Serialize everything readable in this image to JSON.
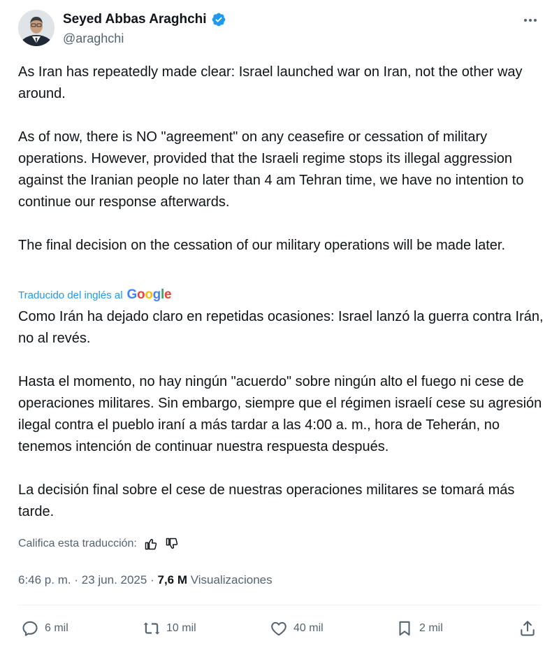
{
  "author": {
    "name": "Seyed Abbas Araghchi",
    "handle": "@araghchi",
    "verified_color": "#1d9bf0"
  },
  "tweet": {
    "paragraphs": [
      "As Iran has repeatedly made clear: Israel launched war on Iran, not the other way around.",
      "As of now, there is NO \"agreement\" on any ceasefire or cessation of military operations. However, provided that the Israeli regime stops its illegal aggression against the Iranian people no later than 4 am Tehran time, we have no intention to continue our response afterwards.",
      "The final decision on the cessation of our military operations will be made later."
    ]
  },
  "translation": {
    "label": "Traducido del inglés al",
    "brand": "Google",
    "paragraphs": [
      "Como Irán ha dejado claro en repetidas ocasiones: Israel lanzó la guerra contra Irán, no al revés.",
      "Hasta el momento, no hay ningún \"acuerdo\" sobre ningún alto el fuego ni cese de operaciones militares. Sin embargo, siempre que el régimen israelí cese su agresión ilegal contra el pueblo iraní a más tardar a las 4:00 a. m., hora de Teherán, no tenemos intención de continuar nuestra respuesta después.",
      "La decisión final sobre el cese de nuestras operaciones militares se tomará más tarde."
    ],
    "rate_label": "Califica esta traducción:"
  },
  "meta": {
    "time": "6:46 p. m.",
    "separator": "·",
    "date": "23 jun. 2025",
    "views_count": "7,6 M",
    "views_label": "Visualizaciones"
  },
  "actions": {
    "replies": "6 mil",
    "reposts": "10 mil",
    "likes": "40 mil",
    "bookmarks": "2 mil"
  },
  "icons": [
    "verified-badge-icon",
    "more-icon",
    "thumbs-up-icon",
    "thumbs-down-icon",
    "reply-icon",
    "repost-icon",
    "like-icon",
    "bookmark-icon",
    "share-icon"
  ]
}
